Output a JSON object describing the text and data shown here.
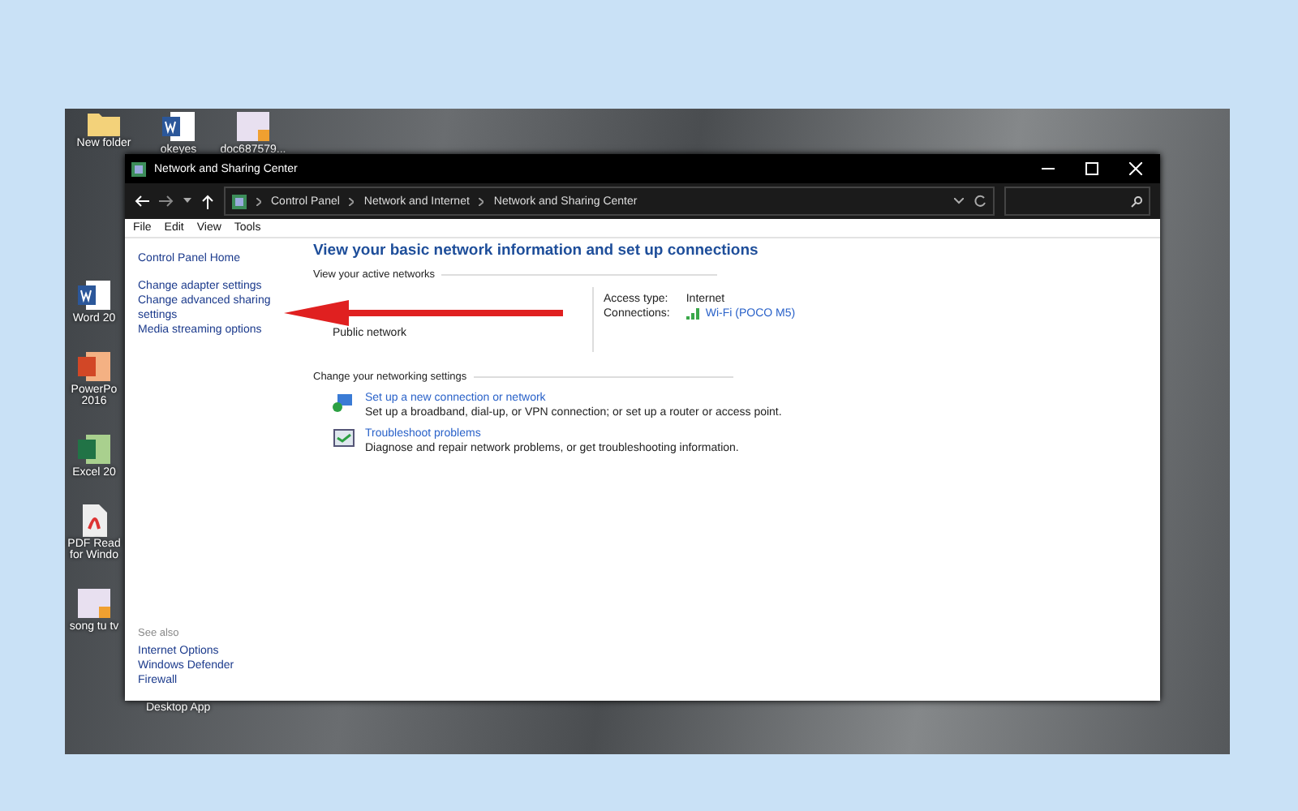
{
  "desktop": {
    "top_icons": [
      {
        "label": "New folder",
        "kind": "folder"
      },
      {
        "label": "okeyes",
        "kind": "word"
      },
      {
        "label": "doc687579...",
        "kind": "image"
      }
    ],
    "side_icons": [
      {
        "label": "Word 20",
        "kind": "word"
      },
      {
        "label": "PowerPo 2016",
        "kind": "powerpoint"
      },
      {
        "label": "Excel 20",
        "kind": "excel"
      },
      {
        "label": "PDF Read for Windo",
        "kind": "pdf"
      },
      {
        "label": "song tu tv",
        "kind": "image"
      }
    ],
    "caption": "Desktop App"
  },
  "window": {
    "title": "Network and Sharing Center",
    "breadcrumb": [
      "Control Panel",
      "Network and Internet",
      "Network and Sharing Center"
    ],
    "menu": [
      "File",
      "Edit",
      "View",
      "Tools"
    ],
    "sidebar": {
      "links": [
        "Control Panel Home",
        "Change adapter settings",
        "Change advanced sharing settings",
        "Media streaming options"
      ],
      "see_also_heading": "See also",
      "see_also": [
        "Internet Options",
        "Windows Defender Firewall"
      ]
    },
    "main": {
      "heading": "View your basic network information and set up connections",
      "active_networks_label": "View your active networks",
      "network": {
        "type": "Public network",
        "access_type_label": "Access type:",
        "access_type": "Internet",
        "connections_label": "Connections:",
        "connection": "Wi-Fi (POCO M5)"
      },
      "settings_label": "Change your networking settings",
      "tasks": [
        {
          "kind": "new-connection",
          "title": "Set up a new connection or network",
          "description": "Set up a broadband, dial-up, or VPN connection; or set up a router or access point."
        },
        {
          "kind": "troubleshoot",
          "title": "Troubleshoot problems",
          "description": "Diagnose and repair network problems, or get troubleshooting information."
        }
      ]
    }
  }
}
